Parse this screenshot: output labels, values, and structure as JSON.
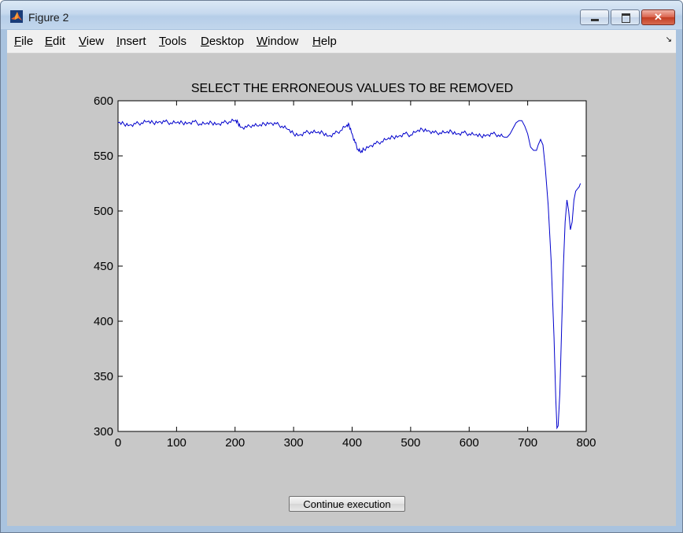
{
  "window": {
    "title": "Figure 2",
    "app_icon": "matlab-icon",
    "controls": {
      "minimize": "minimize-icon",
      "maximize": "maximize-icon",
      "close": "✕"
    }
  },
  "menu": {
    "items": [
      {
        "label": "File",
        "accel": "F",
        "rest": "ile"
      },
      {
        "label": "Edit",
        "accel": "E",
        "rest": "dit"
      },
      {
        "label": "View",
        "accel": "V",
        "rest": "iew"
      },
      {
        "label": "Insert",
        "accel": "I",
        "rest": "nsert"
      },
      {
        "label": "Tools",
        "accel": "T",
        "rest": "ools"
      },
      {
        "label": "Desktop",
        "accel": "D",
        "rest": "esktop"
      },
      {
        "label": "Window",
        "accel": "W",
        "rest": "indow"
      },
      {
        "label": "Help",
        "accel": "H",
        "rest": "elp"
      }
    ],
    "dock_icon": "dock-arrow-icon"
  },
  "button": {
    "continue_label": "Continue execution"
  },
  "colors": {
    "line": "#0000cc",
    "figure_bg": "#c8c8c8",
    "axes_bg": "#ffffff"
  },
  "chart_data": {
    "type": "line",
    "title": "SELECT THE ERRONEOUS VALUES TO BE REMOVED",
    "xlabel": "",
    "ylabel": "",
    "xlim": [
      0,
      800
    ],
    "ylim": [
      300,
      600
    ],
    "xticks": [
      0,
      100,
      200,
      300,
      400,
      500,
      600,
      700,
      800
    ],
    "yticks": [
      300,
      350,
      400,
      450,
      500,
      550,
      600
    ],
    "grid": false,
    "series": [
      {
        "x": [
          0,
          10,
          20,
          30,
          40,
          50,
          60,
          70,
          80,
          90,
          100,
          110,
          120,
          130,
          140,
          150,
          160,
          170,
          180,
          190,
          200,
          205,
          210,
          220,
          230,
          240,
          250,
          260,
          270,
          280,
          290,
          300,
          310,
          320,
          330,
          340,
          350,
          360,
          370,
          380,
          390,
          395,
          400,
          405,
          410,
          415,
          420,
          430,
          440,
          450,
          460,
          470,
          480,
          490,
          500,
          510,
          520,
          530,
          540,
          550,
          560,
          570,
          580,
          590,
          600,
          610,
          620,
          630,
          640,
          650,
          660,
          665,
          670,
          675,
          680,
          685,
          690,
          695,
          700,
          705,
          710,
          715,
          718,
          722,
          726,
          730,
          735,
          740,
          745,
          748,
          750,
          752,
          755,
          758,
          761,
          764,
          767,
          770,
          773,
          776,
          779,
          782,
          785,
          788,
          790
        ],
        "y": [
          580,
          579,
          578,
          579,
          580,
          581,
          580,
          581,
          581,
          580,
          580,
          580,
          580,
          581,
          579,
          579,
          580,
          579,
          580,
          581,
          582,
          580,
          576,
          576,
          578,
          577,
          579,
          580,
          579,
          577,
          574,
          570,
          569,
          571,
          572,
          571,
          571,
          568,
          570,
          573,
          577,
          578,
          570,
          562,
          556,
          553,
          556,
          559,
          561,
          563,
          565,
          567,
          568,
          570,
          569,
          572,
          574,
          573,
          571,
          571,
          571,
          572,
          570,
          571,
          570,
          569,
          568,
          569,
          570,
          569,
          567,
          567,
          570,
          575,
          580,
          582,
          582,
          577,
          570,
          558,
          555,
          555,
          560,
          565,
          560,
          540,
          505,
          455,
          385,
          330,
          303,
          305,
          335,
          395,
          450,
          490,
          510,
          500,
          483,
          490,
          510,
          518,
          520,
          522,
          525
        ]
      }
    ]
  }
}
